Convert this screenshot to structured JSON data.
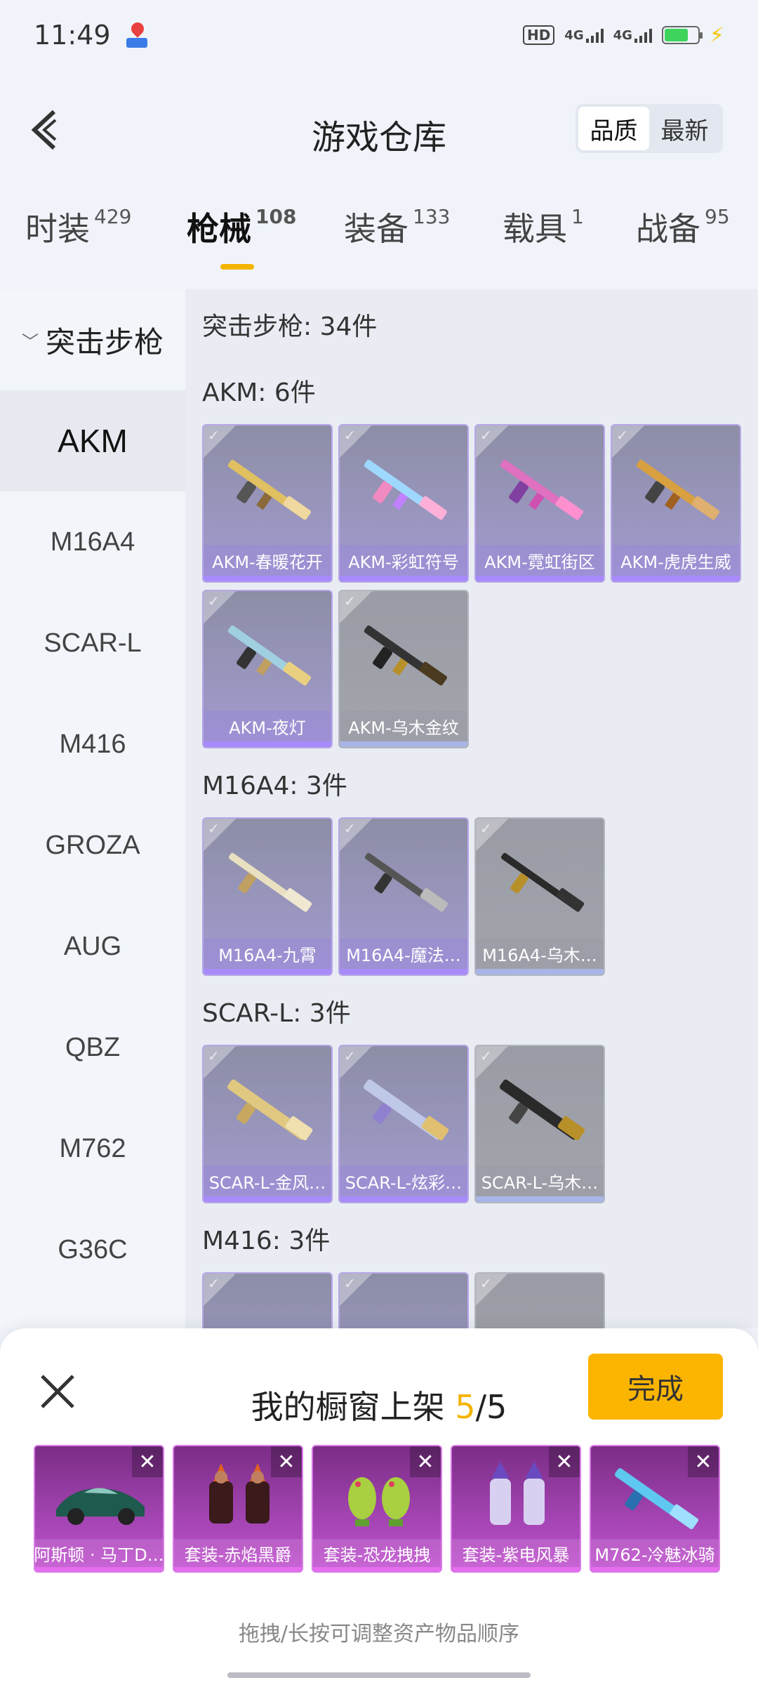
{
  "status": {
    "time": "11:49",
    "hd": "HD",
    "net1": "4G",
    "net2": "4G",
    "map_icon": "map-pin-icon",
    "colors": {
      "battery": "#3ed35a",
      "bolt": "#f5c400"
    }
  },
  "header": {
    "title": "游戏仓库",
    "sort": {
      "options": [
        "品质",
        "最新"
      ],
      "selected": "品质"
    }
  },
  "tabs": [
    {
      "label": "时装",
      "count": "429"
    },
    {
      "label": "枪械",
      "count": "108"
    },
    {
      "label": "装备",
      "count": "133"
    },
    {
      "label": "载具",
      "count": "1"
    },
    {
      "label": "战备",
      "count": "95"
    }
  ],
  "active_tab": "枪械",
  "sidebar": {
    "group": "突击步枪",
    "items": [
      "AKM",
      "M16A4",
      "SCAR-L",
      "M416",
      "GROZA",
      "AUG",
      "QBZ",
      "M762",
      "G36C"
    ],
    "selected": "AKM"
  },
  "main": {
    "summary": "突击步枪: 34件",
    "groups": [
      {
        "label": "AKM: 6件",
        "items": [
          {
            "name": "AKM-春暖花开",
            "grade": "purple"
          },
          {
            "name": "AKM-彩虹符号",
            "grade": "purple"
          },
          {
            "name": "AKM-霓虹街区",
            "grade": "purple"
          },
          {
            "name": "AKM-虎虎生威",
            "grade": "purple"
          },
          {
            "name": "AKM-夜灯",
            "grade": "purple"
          },
          {
            "name": "AKM-乌木金纹",
            "grade": "grey"
          }
        ]
      },
      {
        "label": "M16A4: 3件",
        "items": [
          {
            "name": "M16A4-九霄",
            "grade": "purple"
          },
          {
            "name": "M16A4-魔法…",
            "grade": "purple"
          },
          {
            "name": "M16A4-乌木…",
            "grade": "grey"
          }
        ]
      },
      {
        "label": "SCAR-L: 3件",
        "items": [
          {
            "name": "SCAR-L-金风…",
            "grade": "purple"
          },
          {
            "name": "SCAR-L-炫彩…",
            "grade": "purple"
          },
          {
            "name": "SCAR-L-乌木…",
            "grade": "grey"
          }
        ]
      },
      {
        "label": "M416: 3件",
        "items": [
          {
            "name": "",
            "grade": "purple"
          },
          {
            "name": "",
            "grade": "purple"
          },
          {
            "name": "",
            "grade": "grey"
          }
        ]
      }
    ]
  },
  "panel": {
    "title": "我的橱窗上架",
    "current": "5",
    "total": "/5",
    "done_label": "完成",
    "items": [
      {
        "name": "阿斯顿 · 马丁D…",
        "icon": "car-icon"
      },
      {
        "name": "套装-赤焰黑爵",
        "icon": "outfit-icon"
      },
      {
        "name": "套装-恐龙拽拽",
        "icon": "dino-outfit-icon"
      },
      {
        "name": "套装-紫电风暴",
        "icon": "armor-outfit-icon"
      },
      {
        "name": "M762-冷魅冰骑",
        "icon": "rifle-icon"
      }
    ],
    "hint": "拖拽/长按可调整资产物品顺序",
    "colors": {
      "accent": "#f5b400",
      "done_bg": "#fbb500"
    }
  }
}
